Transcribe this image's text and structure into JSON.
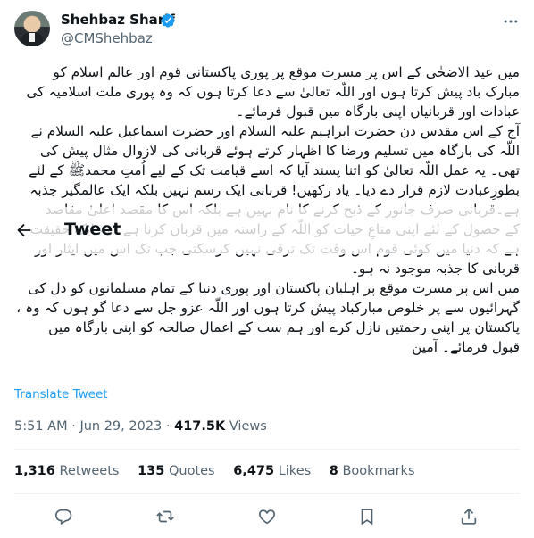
{
  "author": {
    "name": "Shehbaz Sharif",
    "handle": "@CMShehbaz"
  },
  "tweet": {
    "text": "میں عید الاضحٰی کے  اس پر مسرت موقع پر پوری پاکستانی قوم اور عالم اسلام کو\nمبارک باد پیش کرتا ہوں اور اللّہ تعالیٰ سے دعا کرتا ہوں کہ وہ پوری ملت اسلامیہ کی\nعبادات اور قربانیاں اپنی بارگاہ میں قبول فرمائے۔\nآج کے اس مقدس دن حضرت ابراہیم علیہ السلام اور حضرت اسماعیل علیہ السلام نے\nاللّہ کی بارگاہ میں تسلیم ورضا کا اظہار کرتے ہوئے قربانی کی لازوال مثال پیش کی\nتھی۔ یہ عمل اللّہ تعالیٰ کو اتنا پسند آیا کہ اسے قیامت تک کے لیے اُمتِ محمدﷺ کے لئے\nبطورِعبادت لازم قرار دے دیا۔ یاد رکھیں! قربانی ایک رسم نہیں بلکہ ایک عالمگیر جذبہ\nہے۔قربانی صرف جانور کے ذبح کرنے کا نام نہیں ہے بلکہ اس کا مقصد اعلیٰ مقاصد\nکے حصول کے لئے اپنی متاعِ حیات کو اللّہ کے راستہ میں قربان کرنا ہے۔ یہ ایک حقیقت\nہے کہ دنیا میں کوئی قوم اس وقت تک ترقی نہیں کرسکتی جب تک اس میں ایثار اور\nقربانی کا جذبہ موجود نہ ہو۔\nمیں اس پر مسرت موقع پر  اہلیان پاکستان اور پوری دنیا کے تمام مسلمانوں کو دل کی\nگہرائیوں سے پر خلوص مبارکباد پیش کرتا ہوں اور اللّہ عزو جل سے دعا گو ہوں کہ وہ ،\nپاکستان پر اپنی رحمتیں نازل کرے اور ہم سب کے اعمال صالحہ کو اپنی بارگاہ میں\nقبول فرمائے۔ آمین"
  },
  "overlay": {
    "title": "Tweet"
  },
  "translate_label": "Translate Tweet",
  "meta": {
    "time": "5:51 AM",
    "separator": "·",
    "date": "Jun 29, 2023",
    "views_count": "417.5K",
    "views_label": "Views"
  },
  "stats": {
    "retweets_count": "1,316",
    "retweets_label": "Retweets",
    "quotes_count": "135",
    "quotes_label": "Quotes",
    "likes_count": "6,475",
    "likes_label": "Likes",
    "bookmarks_count": "8",
    "bookmarks_label": "Bookmarks"
  },
  "icons": {
    "verified": "verified-badge-icon",
    "more": "more-options-icon",
    "back": "back-arrow-icon",
    "reply": "reply-icon",
    "retweet": "retweet-icon",
    "like": "like-icon",
    "bookmark": "bookmark-icon",
    "share": "share-icon"
  },
  "colors": {
    "accent": "#1d9bf0",
    "text": "#0f1419",
    "secondary": "#536471"
  }
}
